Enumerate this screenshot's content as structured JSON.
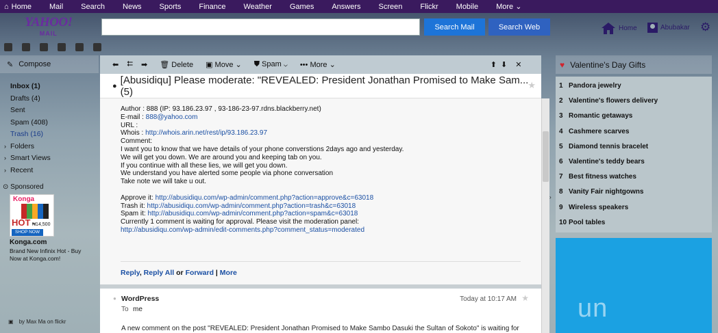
{
  "topnav": {
    "items": [
      "Home",
      "Mail",
      "Search",
      "News",
      "Sports",
      "Finance",
      "Weather",
      "Games",
      "Answers",
      "Screen",
      "Flickr",
      "Mobile",
      "More"
    ]
  },
  "logo": {
    "text": "YAHOO!",
    "sub": "MAIL"
  },
  "search": {
    "value": "",
    "mail_button": "Search Mail",
    "web_button": "Search Web"
  },
  "header": {
    "home_label": "Home",
    "user_name": "Abubakar"
  },
  "sidebar": {
    "compose": "Compose",
    "folders": [
      {
        "label": "Inbox (1)"
      },
      {
        "label": "Drafts (4)"
      },
      {
        "label": "Sent"
      },
      {
        "label": "Spam (408)"
      },
      {
        "label": "Trash (16)"
      },
      {
        "label": "Folders"
      },
      {
        "label": "Smart Views"
      },
      {
        "label": "Recent"
      }
    ],
    "sponsored": "Sponsored",
    "ad": {
      "brand": "Konga",
      "badge": "HOT",
      "price": "₦14,500",
      "cta": "SHOP NOW",
      "title": "Konga.com",
      "desc": "Brand New Infinix Hot - Buy Now at Konga.com!"
    },
    "flickr": "by Max Ma on flickr"
  },
  "toolbar": {
    "delete": "Delete",
    "move": "Move",
    "spam": "Spam",
    "more": "More"
  },
  "message": {
    "subject": "[Abusidiqu] Please moderate: \"REVEALED: President Jonathan Promised to Make Sam... (5)",
    "lines": [
      "Author : 888 (IP: 93.186.23.97 , 93-186-23-97.rdns.blackberry.net)",
      "E-mail : ",
      "URL    :",
      "Whois  : ",
      "Comment:",
      "I want you to know that we have details of your phone converstions 2days ago and yesterday.",
      "We will get you down. We are around you and keeping tab on you.",
      "If you continue with all these lies, we will get you down.",
      "We understand you have alerted some people via phone conversation",
      "Take note we will take u out.",
      "",
      "Approve it: ",
      "Trash it: ",
      "Spam it: ",
      "Currently 1 comment is waiting for approval. Please visit the moderation panel:"
    ],
    "email_link": "888@yahoo.com",
    "whois_link": "http://whois.arin.net/rest/ip/93.186.23.97",
    "approve_link": "http://abusidiqu.com/wp-admin/comment.php?action=approve&c=63018",
    "trash_link": "http://abusidiqu.com/wp-admin/comment.php?action=trash&c=63018",
    "spam_link": "http://abusidiqu.com/wp-admin/comment.php?action=spam&c=63018",
    "panel_link": "http://abusidiqu.com/wp-admin/edit-comments.php?comment_status=moderated",
    "reply": "Reply",
    "reply_all": "Reply All",
    "or": "or",
    "forward": "Forward",
    "sep": "|",
    "more": "More"
  },
  "message2": {
    "from": "WordPress",
    "date": "Today at 10:17 AM",
    "to_label": "To",
    "to": "me",
    "preview": "A new comment on the post \"REVEALED: President Jonathan Promised to Make Sambo Dasuki the Sultan of Sokoto\" is waiting for"
  },
  "right_panel": {
    "title": "Valentine's Day Gifts",
    "items": [
      "Pandora jewelry",
      "Valentine's flowers delivery",
      "Romantic getaways",
      "Cashmere scarves",
      "Diamond tennis bracelet",
      "Valentine's teddy bears",
      "Best fitness watches",
      "Vanity Fair nightgowns",
      "Wireless speakers",
      "Pool tables"
    ],
    "ad_text": "un"
  },
  "colors": {
    "topnav": "#3a1a5e",
    "search_mail": "#1d74d8",
    "search_web": "#2f62c0",
    "link": "#1a4fa3",
    "ad_blue": "#1ba1e2"
  }
}
